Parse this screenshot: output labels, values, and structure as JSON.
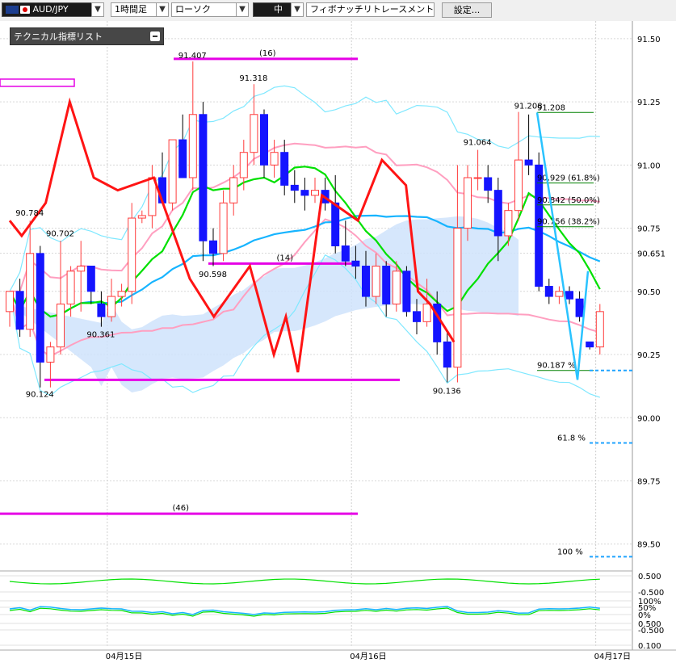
{
  "toolbar": {
    "symbol": "AUD/JPY",
    "timeframe": "1時間足",
    "chart_style": "ローソク",
    "line_width": "中",
    "drawing_tool": "フィボナッチリトレースメント",
    "settings_label": "設定..."
  },
  "indicator_panel": {
    "title": "テクニカル指標リスト"
  },
  "colors": {
    "bull": "#ff3b3b",
    "bear": "#1414ff",
    "ma_short": "#00e000",
    "ma_mid": "#16b4ff",
    "ichimoku_cloud": "#cfe3fb",
    "bollinger_outer": "#7fe8ff",
    "bollinger_inner": "#ff9fc0",
    "zigzag": "#ff1414",
    "hline": "#e600e6",
    "fib": "#008000"
  },
  "chart_data": {
    "type": "candlestick",
    "price_axis": [
      "91.50",
      "91.25",
      "91.00",
      "90.75",
      "90.651",
      "90.50",
      "90.25",
      "90.00",
      "89.75",
      "89.50"
    ],
    "price_range": [
      89.4,
      91.57
    ],
    "date_labels": [
      {
        "label": "04月15日",
        "at": 8
      },
      {
        "label": "04月16日",
        "at": 32
      },
      {
        "label": "04月17日",
        "at": 56
      }
    ],
    "peak_labels": [
      {
        "text": "90.784",
        "i": 2,
        "v": 90.784,
        "pos": "above"
      },
      {
        "text": "90.702",
        "i": 5,
        "v": 90.702,
        "pos": "above"
      },
      {
        "text": "90.361",
        "i": 9,
        "v": 90.361,
        "pos": "below"
      },
      {
        "text": "90.124",
        "i": 3,
        "v": 90.124,
        "pos": "below"
      },
      {
        "text": "91.407",
        "i": 18,
        "v": 91.407,
        "pos": "above"
      },
      {
        "text": "90.598",
        "i": 20,
        "v": 90.598,
        "pos": "below"
      },
      {
        "text": "91.318",
        "i": 24,
        "v": 91.318,
        "pos": "above"
      },
      {
        "text": "90.136",
        "i": 43,
        "v": 90.136,
        "pos": "below"
      },
      {
        "text": "91.064",
        "i": 46,
        "v": 91.064,
        "pos": "above"
      },
      {
        "text": "91.208",
        "i": 51,
        "v": 91.208,
        "pos": "above"
      }
    ],
    "candles": [
      [
        90.42,
        90.5,
        90.36,
        90.5
      ],
      [
        90.5,
        90.55,
        90.32,
        90.35
      ],
      [
        90.35,
        90.78,
        90.32,
        90.65
      ],
      [
        90.65,
        90.68,
        90.12,
        90.22
      ],
      [
        90.22,
        90.3,
        90.12,
        90.28
      ],
      [
        90.28,
        90.7,
        90.25,
        90.45
      ],
      [
        90.45,
        90.6,
        90.4,
        90.58
      ],
      [
        90.58,
        90.7,
        90.42,
        90.6
      ],
      [
        90.6,
        90.6,
        90.45,
        90.5
      ],
      [
        90.45,
        90.5,
        90.36,
        90.4
      ],
      [
        90.4,
        90.55,
        90.38,
        90.48
      ],
      [
        90.48,
        90.53,
        90.44,
        90.5
      ],
      [
        90.5,
        90.85,
        90.45,
        90.79
      ],
      [
        90.79,
        90.82,
        90.77,
        90.8
      ],
      [
        90.8,
        91.0,
        90.75,
        90.95
      ],
      [
        90.95,
        91.05,
        90.9,
        90.85
      ],
      [
        90.85,
        91.1,
        90.82,
        91.1
      ],
      [
        91.1,
        91.2,
        90.95,
        90.95
      ],
      [
        90.95,
        91.41,
        90.9,
        91.2
      ],
      [
        91.2,
        91.25,
        90.62,
        90.7
      ],
      [
        90.7,
        90.75,
        90.6,
        90.65
      ],
      [
        90.65,
        90.9,
        90.62,
        90.85
      ],
      [
        90.85,
        91.0,
        90.8,
        90.95
      ],
      [
        90.95,
        91.1,
        90.9,
        91.05
      ],
      [
        91.05,
        91.32,
        91.0,
        91.2
      ],
      [
        91.2,
        91.22,
        90.95,
        91.0
      ],
      [
        91.0,
        91.1,
        90.95,
        91.05
      ],
      [
        91.05,
        91.1,
        90.88,
        90.92
      ],
      [
        90.92,
        90.98,
        90.85,
        90.9
      ],
      [
        90.9,
        90.95,
        90.82,
        90.88
      ],
      [
        90.88,
        90.95,
        90.85,
        90.9
      ],
      [
        90.9,
        90.95,
        90.82,
        90.85
      ],
      [
        90.85,
        90.96,
        90.65,
        90.68
      ],
      [
        90.68,
        90.78,
        90.6,
        90.62
      ],
      [
        90.62,
        90.68,
        90.55,
        90.6
      ],
      [
        90.6,
        90.66,
        90.44,
        90.48
      ],
      [
        90.48,
        90.65,
        90.45,
        90.6
      ],
      [
        90.6,
        90.62,
        90.4,
        90.45
      ],
      [
        90.45,
        90.62,
        90.42,
        90.58
      ],
      [
        90.58,
        90.6,
        90.4,
        90.42
      ],
      [
        90.42,
        90.47,
        90.33,
        90.38
      ],
      [
        90.38,
        90.55,
        90.36,
        90.45
      ],
      [
        90.45,
        90.5,
        90.25,
        90.3
      ],
      [
        90.3,
        90.34,
        90.14,
        90.2
      ],
      [
        90.2,
        91.0,
        90.14,
        90.75
      ],
      [
        90.75,
        91.0,
        90.7,
        90.95
      ],
      [
        90.95,
        91.06,
        90.9,
        90.95
      ],
      [
        90.95,
        91.0,
        90.85,
        90.9
      ],
      [
        90.9,
        90.95,
        90.62,
        90.72
      ],
      [
        90.72,
        90.85,
        90.68,
        90.82
      ],
      [
        90.82,
        91.21,
        90.78,
        91.02
      ],
      [
        91.02,
        91.2,
        90.96,
        91.0
      ],
      [
        91.0,
        91.05,
        90.5,
        90.52
      ],
      [
        90.52,
        90.55,
        90.45,
        90.48
      ],
      [
        90.48,
        90.52,
        90.45,
        90.5
      ],
      [
        90.5,
        90.52,
        90.45,
        90.47
      ],
      [
        90.47,
        90.5,
        90.38,
        90.4
      ],
      [
        90.3,
        90.3,
        90.27,
        90.28
      ],
      [
        90.28,
        90.45,
        90.25,
        90.42
      ]
    ],
    "horizontal_lines": [
      {
        "label": "(16)",
        "y": 91.42
      },
      {
        "label": "(14)",
        "y": 90.61
      },
      {
        "label": "(46)",
        "y": 89.62
      },
      {
        "label": "",
        "y": 90.15
      }
    ],
    "fibonacci": [
      {
        "label": "91.208",
        "v": 91.208
      },
      {
        "label": "90.929 (61.8%)",
        "v": 90.929
      },
      {
        "label": "90.842 (50.0%)",
        "v": 90.842
      },
      {
        "label": "90.756 (38.2%)",
        "v": 90.756
      },
      {
        "label": "90.187 %",
        "v": 90.187
      },
      {
        "label": "61.8 %",
        "v": 89.9
      },
      {
        "label": "100 %",
        "v": 89.45
      }
    ],
    "oscillator_axis": [
      "0.500",
      "-0.500",
      "100%",
      "50%",
      "0%",
      "0.500",
      "-0.500",
      "0.100"
    ]
  }
}
